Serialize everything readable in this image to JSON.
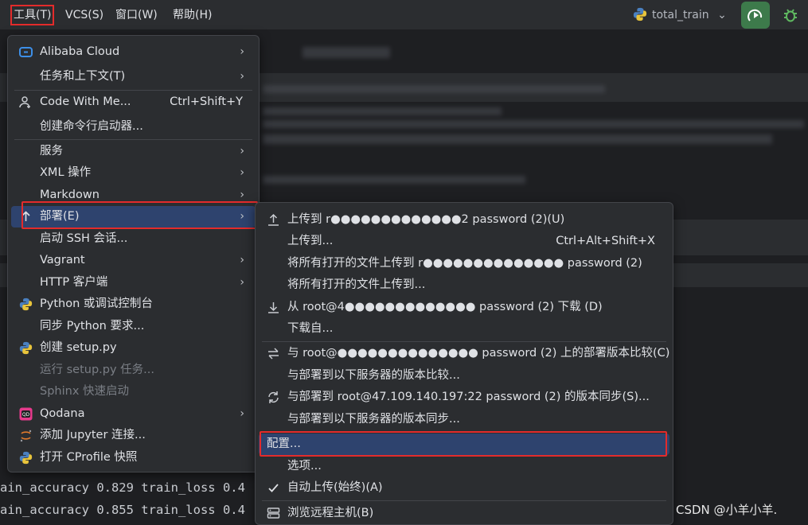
{
  "menubar": {
    "tools": "工具(T)",
    "vcs": "VCS(S)",
    "window": "窗口(W)",
    "help": "帮助(H)",
    "run_config": "total_train"
  },
  "tools_menu": [
    {
      "label": "Alibaba Cloud",
      "icon": "alibaba-cloud-icon",
      "submenu": true
    },
    {
      "label": "任务和上下文(T)",
      "submenu": true
    },
    {
      "label": "Code With Me...",
      "icon": "code-with-me-icon",
      "shortcut": "Ctrl+Shift+Y"
    },
    {
      "label": "创建命令行启动器..."
    },
    {
      "label": "服务",
      "submenu": true
    },
    {
      "label": "XML 操作",
      "submenu": true
    },
    {
      "label": "Markdown",
      "submenu": true
    },
    {
      "label": "部署(E)",
      "icon": "upload-arrow-icon",
      "submenu": true,
      "selected": true
    },
    {
      "label": "启动 SSH 会话..."
    },
    {
      "label": "Vagrant",
      "submenu": true
    },
    {
      "label": "HTTP 客户端",
      "submenu": true
    },
    {
      "label": "Python 或调试控制台",
      "icon": "python-icon"
    },
    {
      "label": "同步 Python 要求..."
    },
    {
      "label": "创建 setup.py",
      "icon": "python-icon"
    },
    {
      "label": "运行 setup.py 任务...",
      "disabled": true
    },
    {
      "label": "Sphinx 快速启动",
      "disabled": true
    },
    {
      "label": "Qodana",
      "icon": "qodana-icon",
      "submenu": true
    },
    {
      "label": "添加 Jupyter 连接...",
      "icon": "jupyter-icon"
    },
    {
      "label": "打开 CProfile 快照",
      "icon": "cprofile-icon"
    }
  ],
  "deploy_menu": [
    {
      "label": "上传到 r●●●●●●●●●●●●●2 password (2)(U)",
      "icon": "upload-icon"
    },
    {
      "label": "上传到...",
      "shortcut": "Ctrl+Alt+Shift+X"
    },
    {
      "label": "将所有打开的文件上传到 r●●●●●●●●●●●●●● password (2)"
    },
    {
      "label": "将所有打开的文件上传到..."
    },
    {
      "label": "从 root@4●●●●●●●●●●●●● password (2) 下载 (D)",
      "icon": "download-icon"
    },
    {
      "label": "下载自..."
    },
    {
      "label": "与 root@●●●●●●●●●●●●●● password (2) 上的部署版本比较(C)",
      "icon": "compare-icon"
    },
    {
      "label": "与部署到以下服务器的版本比较..."
    },
    {
      "label": "与部署到 root@47.109.140.197:22 password (2) 的版本同步(S)...",
      "icon": "sync-icon"
    },
    {
      "label": "与部署到以下服务器的版本同步..."
    },
    {
      "label": "配置...",
      "selected": true
    },
    {
      "label": "选项..."
    },
    {
      "label": "自动上传(始终)(A)",
      "icon": "check-icon"
    },
    {
      "label": "浏览远程主机(B)",
      "icon": "remote-host-icon"
    }
  ],
  "log_lines": [
    "ain_accuracy 0.829 train_loss 0.4",
    "ain_accuracy 0.855 train_loss 0.4"
  ],
  "watermark": "CSDN @小羊小羊.",
  "colors": {
    "background": "#1e1f22",
    "menu_bg": "#2b2d30",
    "selected": "#2e436e",
    "highlight_red": "#e32b2b",
    "run_green": "#3d7a4b"
  }
}
